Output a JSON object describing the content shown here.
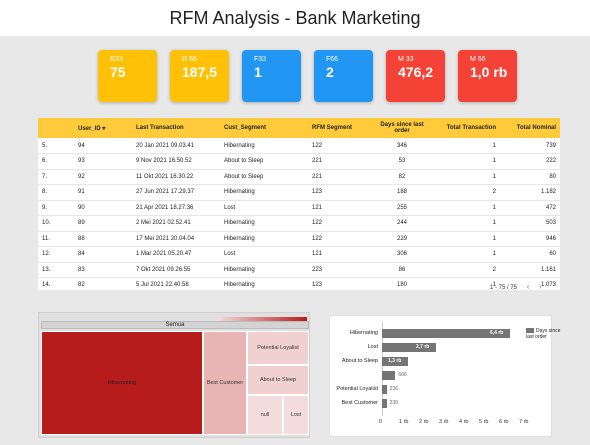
{
  "title": "RFM Analysis - Bank Marketing",
  "cards": [
    {
      "label": "R33",
      "value": "75",
      "color": "#ffc107"
    },
    {
      "label": "R 66",
      "value": "187,5",
      "color": "#ffc107"
    },
    {
      "label": "F33",
      "value": "1",
      "color": "#2196f3"
    },
    {
      "label": "F66",
      "value": "2",
      "color": "#2196f3"
    },
    {
      "label": "M 33",
      "value": "476,2",
      "color": "#f44336"
    },
    {
      "label": "M 66",
      "value": "1,0 rb",
      "color": "#f44336"
    }
  ],
  "table": {
    "header_color": "#ffcb3a",
    "columns": [
      "",
      "User_ID ▾",
      "Last Transaction",
      "Cust_Segment",
      "RFM Segment",
      "Days since last order",
      "Total Transaction",
      "Total Nominal"
    ],
    "rows": [
      [
        "5.",
        "94",
        "20 Jan 2021 09.03.41",
        "Hibernating",
        "122",
        "346",
        "1",
        "739"
      ],
      [
        "6.",
        "93",
        "9 Nov 2021 16.50.52",
        "About to Sleep",
        "221",
        "53",
        "1",
        "222"
      ],
      [
        "7.",
        "92",
        "11 Okt 2021 16.30.22",
        "About to Sleep",
        "221",
        "82",
        "1",
        "80"
      ],
      [
        "8.",
        "91",
        "27 Jun 2021 17.29.37",
        "Hibernating",
        "123",
        "188",
        "2",
        "1.182"
      ],
      [
        "9.",
        "90",
        "21 Apr 2021 18.27.36",
        "Lost",
        "121",
        "255",
        "1",
        "472"
      ],
      [
        "10.",
        "89",
        "2 Mei 2021 02.52.41",
        "Hibernating",
        "122",
        "244",
        "1",
        "503"
      ],
      [
        "11.",
        "88",
        "17 Mei 2021 20.04.04",
        "Hibernating",
        "122",
        "229",
        "1",
        "946"
      ],
      [
        "12.",
        "84",
        "1 Mar 2021 05.20.47",
        "Lost",
        "121",
        "306",
        "1",
        "60"
      ],
      [
        "13.",
        "83",
        "7 Okt 2021 09.26.55",
        "Hibernating",
        "223",
        "86",
        "2",
        "1.161"
      ],
      [
        "14.",
        "82",
        "5 Jul 2021 22.40.58",
        "Hibernating",
        "123",
        "180",
        "1",
        "1.073"
      ]
    ],
    "pager": "1 - 75 / 75",
    "prev_icon": "‹",
    "next_icon": "›"
  },
  "treemap": {
    "title": "Semua",
    "cells": [
      {
        "label": "Hibernating",
        "color": "#b71c1c"
      },
      {
        "label": "Best Customer",
        "color": "#e8b4b4"
      },
      {
        "label": "Potential Loyalist",
        "color": "#f1d0d0"
      },
      {
        "label": "About to Sleep",
        "color": "#f1d0d0"
      },
      {
        "label": "null",
        "color": "#f5dcdc"
      },
      {
        "label": "Lost",
        "color": "#f5dcdc"
      }
    ]
  },
  "chart_data": {
    "type": "bar",
    "orientation": "horizontal",
    "categories": [
      "Hibernating",
      "Lost",
      "About to Sleep",
      "",
      "Potential Loyalist",
      "Best Customer"
    ],
    "series": [
      {
        "name": "Days since last order",
        "values": [
          6400,
          2700,
          1300,
          666,
          236,
          230
        ]
      }
    ],
    "value_labels": [
      "6,4 rb",
      "2,7 rb",
      "1,3 rb",
      "666",
      "236",
      "230"
    ],
    "xticks": [
      "0",
      "1 rb",
      "2 rb",
      "3 rb",
      "4 rb",
      "5 rb",
      "6 rb",
      "7 rb"
    ],
    "xlim": [
      0,
      7000
    ],
    "legend": "top-right",
    "bar_color": "#757575"
  }
}
